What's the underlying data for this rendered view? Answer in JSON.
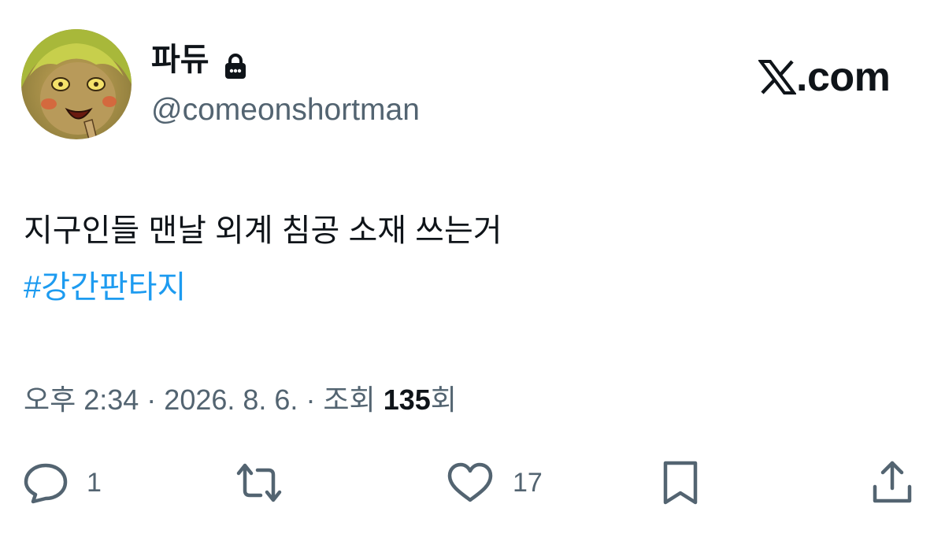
{
  "author": {
    "display_name": "파듀",
    "handle": "@comeonshortman",
    "protected_icon": "lock-icon",
    "avatar": "avatar"
  },
  "brand": {
    "icon": "x-logo-icon",
    "text": ".com"
  },
  "tweet": {
    "text": "지구인들 맨날 외계 침공 소재 쓰는거",
    "hashtag": "#강간판타지"
  },
  "meta": {
    "timestamp": "오후 2:34 · 2026. 8. 6. · 조회 ",
    "views": "135",
    "views_suffix": "회"
  },
  "actions": {
    "reply": {
      "icon": "reply-icon",
      "count": "1"
    },
    "retweet": {
      "icon": "retweet-icon"
    },
    "like": {
      "icon": "heart-icon",
      "count": "17"
    },
    "bookmark": {
      "icon": "bookmark-icon"
    },
    "share": {
      "icon": "share-icon"
    }
  },
  "colors": {
    "text": "#0f1419",
    "secondary": "#536471",
    "link": "#1d9bf0"
  }
}
